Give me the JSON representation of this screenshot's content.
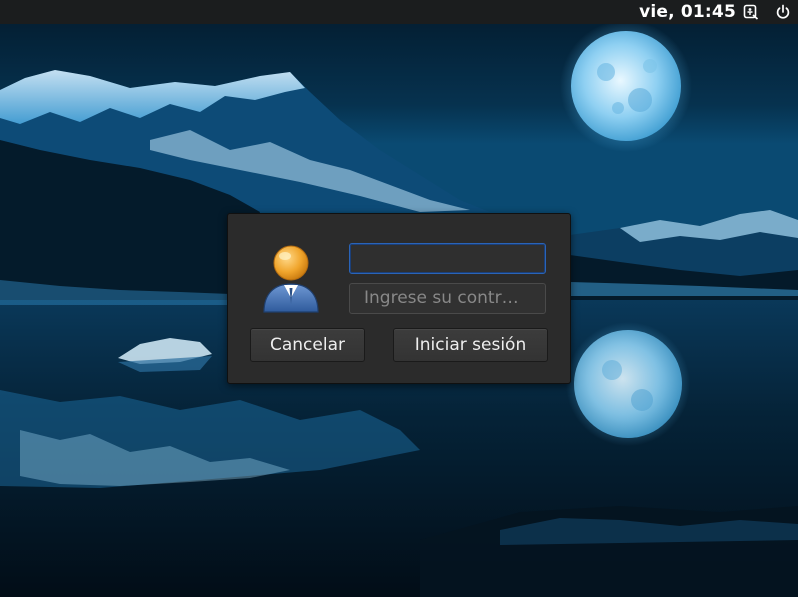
{
  "topbar": {
    "clock": "vie, 01:45",
    "icons": [
      "accessibility-icon",
      "power-icon"
    ]
  },
  "login": {
    "username_value": "",
    "password_placeholder": "Ingrese su contr…",
    "cancel_label": "Cancelar",
    "login_label": "Iniciar sesión",
    "avatar_icon": "user-avatar-icon"
  },
  "colors": {
    "topbar_bg": "#1b1d1e",
    "dialog_bg": "#2b2b2b",
    "focus_border": "#2a64b8",
    "wallpaper_sky": "#06324f"
  }
}
